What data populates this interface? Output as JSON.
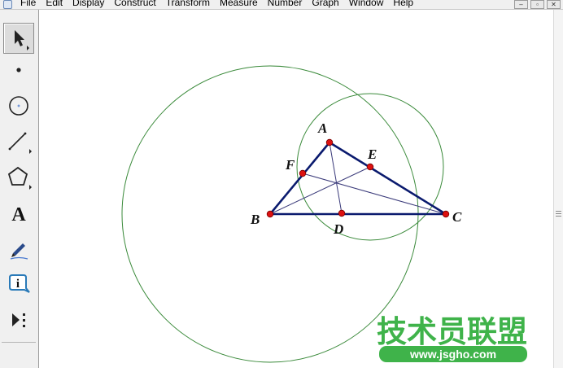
{
  "menubar": {
    "items": [
      "File",
      "Edit",
      "Display",
      "Construct",
      "Transform",
      "Measure",
      "Number",
      "Graph",
      "Window",
      "Help"
    ],
    "window_controls": [
      "–",
      "▫",
      "✕"
    ]
  },
  "toolbox": {
    "tools": [
      {
        "name": "arrow-tool",
        "icon": "arrow-icon",
        "selected": true
      },
      {
        "name": "point-tool",
        "icon": "point-icon",
        "selected": false
      },
      {
        "name": "compass-tool",
        "icon": "compass-icon",
        "selected": false
      },
      {
        "name": "straightedge-tool",
        "icon": "line-icon",
        "selected": false
      },
      {
        "name": "polygon-tool",
        "icon": "pentagon-icon",
        "selected": false
      },
      {
        "name": "text-tool",
        "icon": "text-icon",
        "selected": false
      },
      {
        "name": "marker-tool",
        "icon": "pen-icon",
        "selected": false
      },
      {
        "name": "information-tool",
        "icon": "info-icon",
        "selected": false
      },
      {
        "name": "custom-tool",
        "icon": "custom-tools-icon",
        "selected": false
      }
    ],
    "text_tool_glyph": "A",
    "info_tool_glyph": "i"
  },
  "sketch": {
    "points": {
      "A": "A",
      "B": "B",
      "C": "C",
      "D": "D",
      "E": "E",
      "F": "F"
    },
    "colors": {
      "triangle": "#0a1a6e",
      "cevians": "#3a3a7a",
      "circles": "#3a8a3a",
      "points": "#dd1111"
    }
  },
  "watermark": {
    "text": "技术员联盟",
    "url": "www.jsgho.com",
    "color": "#3fb34a"
  }
}
